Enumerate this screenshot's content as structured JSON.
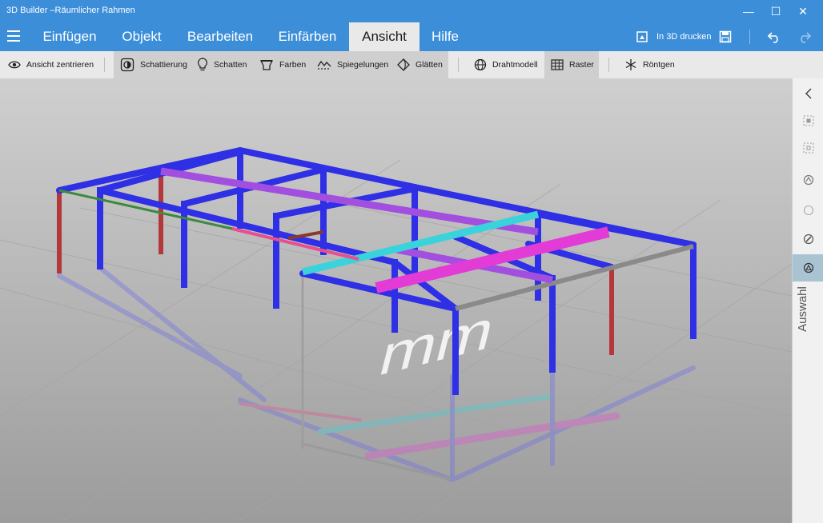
{
  "window": {
    "title": "3D Builder –Räumlicher Rahmen",
    "controls": {
      "minimize": "—",
      "maximize": "☐",
      "close": "✕"
    }
  },
  "ribbon": {
    "tabs": [
      "Einfügen",
      "Objekt",
      "Bearbeiten",
      "Einfärben",
      "Ansicht",
      "Hilfe"
    ],
    "active_tab": "Ansicht",
    "print3d_label": "In 3D drucken"
  },
  "toolbar": {
    "center_view": "Ansicht zentrieren",
    "shading": "Schattierung",
    "shadows": "Schatten",
    "colors": "Farben",
    "reflections": "Spiegelungen",
    "smooth": "Glätten",
    "wireframe": "Drahtmodell",
    "grid": "Raster",
    "xray": "Röntgen"
  },
  "viewport": {
    "unit_label": "mm"
  },
  "sidebar": {
    "vertical_label": "Auswahl"
  },
  "colors": {
    "accent": "#3c8ed9",
    "beam_blue": "#2f2fe6",
    "beam_purple": "#a24fe0",
    "beam_magenta": "#e23bd6",
    "beam_cyan": "#3ad3dc",
    "beam_red": "#b3373b",
    "beam_green": "#3c8a3c",
    "beam_pink": "#e84f8e",
    "beam_gray": "#8a8a8a"
  }
}
